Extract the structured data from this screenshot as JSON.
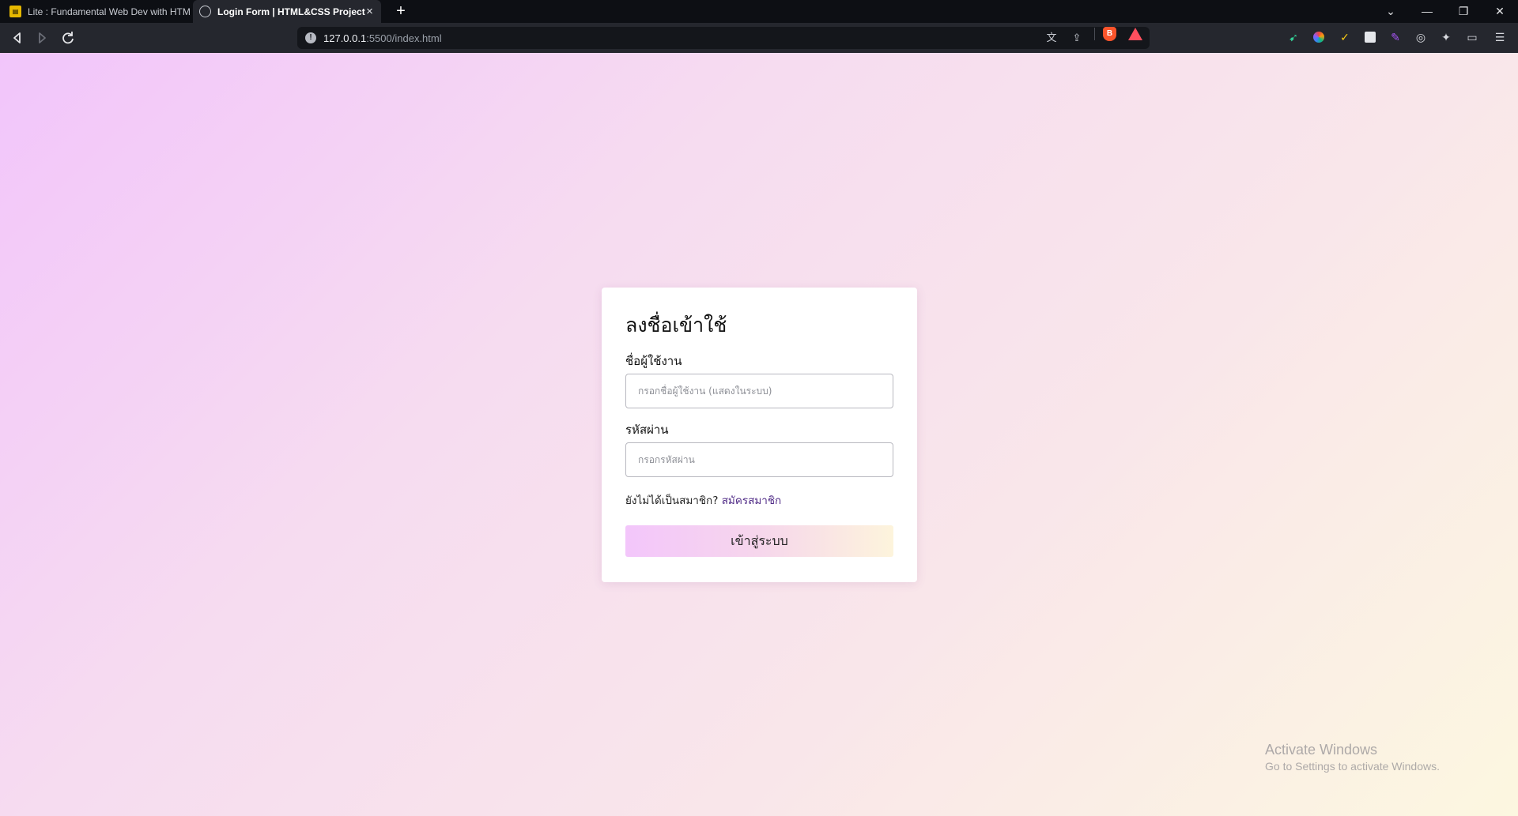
{
  "browser": {
    "tabs": [
      {
        "title": "Lite : Fundamental Web Dev with HTM",
        "active": false,
        "favicon": "lite-favicon-icon"
      },
      {
        "title": "Login Form | HTML&CSS Project",
        "active": true,
        "favicon": "globe-icon"
      }
    ],
    "url": {
      "host": "127.0.0.1",
      "path": ":5500/index.html"
    },
    "icons": {
      "back": "‹",
      "forward": "›",
      "reload": "⟳",
      "new_tab": "+",
      "close_tab": "×",
      "tab_list": "⌄",
      "minimize": "—",
      "restore": "❐",
      "close": "✕",
      "info": "!",
      "translate": "文",
      "share": "⇪",
      "menu": "☰"
    }
  },
  "login": {
    "title": "ลงชื่อเข้าใช้",
    "username_label": "ชื่อผู้ใช้งาน",
    "username_placeholder": "กรอกชื่อผู้ใช้งาน (แสดงในระบบ)",
    "password_label": "รหัสผ่าน",
    "password_placeholder": "กรอกรหัสผ่าน",
    "signup_prompt": "ยังไม่ได้เป็นสมาชิก?",
    "signup_link": "สมัครสมาชิก",
    "submit_label": "เข้าสู่ระบบ"
  },
  "watermark": {
    "title": "Activate Windows",
    "subtitle": "Go to Settings to activate Windows."
  },
  "colors": {
    "background_gradient": [
      "#f2c5fb",
      "#fcf7e0"
    ],
    "button_gradient": [
      "#f3c6fb",
      "#fdf4dc"
    ],
    "link": "#4f2a86"
  }
}
